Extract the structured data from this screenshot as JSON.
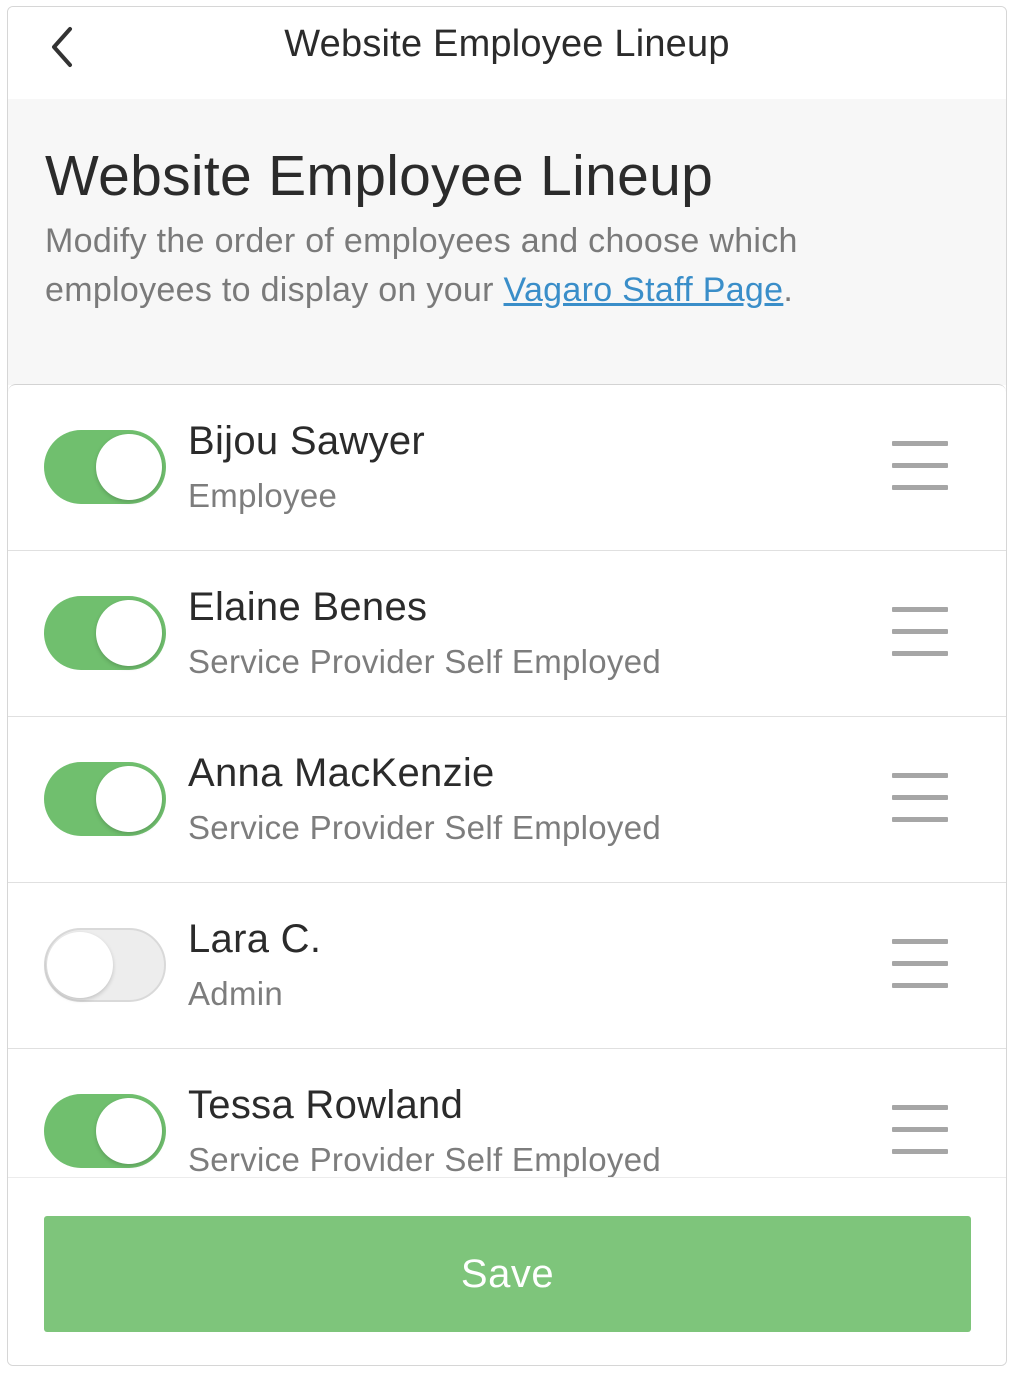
{
  "navbar": {
    "title": "Website Employee Lineup",
    "back_icon": "chevron-left-icon"
  },
  "header": {
    "title": "Website Employee Lineup",
    "description_prefix": "Modify the order of employees and choose which employees to display on your ",
    "link_text": "Vagaro Staff Page",
    "description_suffix": "."
  },
  "employees": [
    {
      "name": "Bijou Sawyer",
      "role": "Employee",
      "visible": true
    },
    {
      "name": "Elaine Benes",
      "role": "Service Provider Self Employed",
      "visible": true
    },
    {
      "name": "Anna MacKenzie",
      "role": "Service Provider Self Employed",
      "visible": true
    },
    {
      "name": "Lara C.",
      "role": "Admin",
      "visible": false
    },
    {
      "name": "Tessa Rowland",
      "role": "Service Provider Self Employed",
      "visible": true
    }
  ],
  "footer": {
    "save_label": "Save"
  },
  "colors": {
    "toggle_on": "#70bf6e",
    "save_button": "#7ec57b",
    "link": "#3a8ec9"
  }
}
